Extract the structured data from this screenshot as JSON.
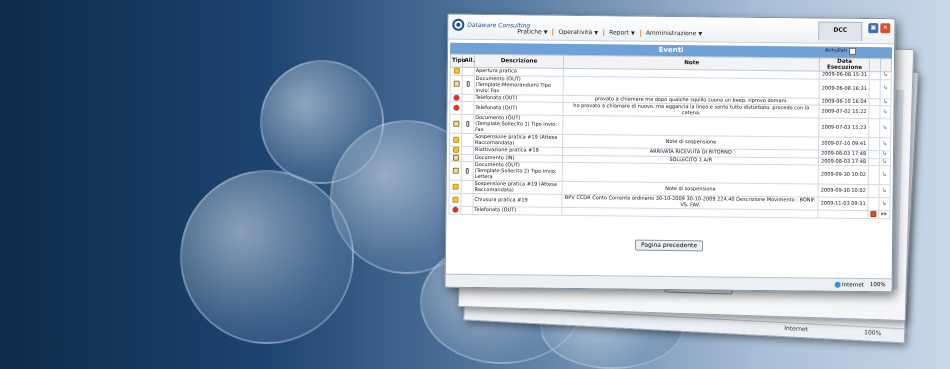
{
  "window": {
    "logo_text": "Dataware Consulting",
    "tab_label": "DCC",
    "menu": [
      "Pratiche",
      "Operatività",
      "Report",
      "Amministrazione"
    ],
    "section_title": "Eventi",
    "annullati_label": "Annullati",
    "columns": [
      "Tipo",
      "All.",
      "Descrizione",
      "Note",
      "Data Esecuzione"
    ],
    "rows": [
      {
        "icon": "folder-icon",
        "attach": false,
        "desc": "Apertura pratica",
        "note": "",
        "date": "2009-06-08 15:31"
      },
      {
        "icon": "document-icon",
        "attach": true,
        "desc": "Documento (OUT) (Template:Memorandum) Tipo invio: Fax",
        "note": "",
        "date": "2009-06-08 16:31"
      },
      {
        "icon": "phone-icon",
        "attach": false,
        "desc": "Telefonata (OUT)",
        "note": "provato a chiamare ma dopo qualche squillo suona un beep. riprovo domani.",
        "date": "2009-06-10 16:04"
      },
      {
        "icon": "phone-icon",
        "attach": false,
        "desc": "Telefonata (OUT)",
        "note": "ho provato a chiamare di nuovo. ma aggancia la linea e sento tutto disturbato. procedo con la catena.",
        "date": "2009-07-02 15:22"
      },
      {
        "icon": "document-icon",
        "attach": true,
        "desc": "Documento (OUT) (Template:Sollecito 1) Tipo invio: Fax",
        "note": "",
        "date": "2009-07-03 15:23"
      },
      {
        "icon": "folder-icon",
        "attach": false,
        "desc": "Sospensione pratica #19 (Attesa Raccomandata)",
        "note": "Note di sospensione",
        "date": "2009-07-10 09:41"
      },
      {
        "icon": "folder-icon",
        "attach": false,
        "desc": "Riattivazione pratica #19",
        "note": "ARRIVATA RICEVUTA DI RITORNO",
        "date": "2009-08-03 17:48"
      },
      {
        "icon": "document-icon",
        "attach": false,
        "desc": "Documento (IN)",
        "note": "SOLLECITO 1 A/R",
        "date": "2009-08-03 17:48"
      },
      {
        "icon": "document-icon",
        "attach": true,
        "desc": "Documento (OUT) (Template:Sollecito 2) Tipo invio: Lettera",
        "note": "",
        "date": "2009-09-30 10:02"
      },
      {
        "icon": "folder-icon",
        "attach": false,
        "desc": "Sospensione pratica #19 (Attesa Raccomandata)",
        "note": "Note di sospensione",
        "date": "2009-09-30 10:02"
      },
      {
        "icon": "folder-icon",
        "attach": false,
        "desc": "Chiusura pratica #19",
        "note": "BPV CCDR Conto Corrente ordinario 30-10-2009 30-10-2009 224.40 Descrizione Movimento : BONIF. VS. FAV.",
        "date": "2009-11-03 09:31"
      },
      {
        "icon": "phone-icon",
        "attach": false,
        "desc": "Telefonata (OUT)",
        "note": "",
        "date": ""
      }
    ],
    "prev_page": "Pagina precedente",
    "status_zone": "Internet",
    "zoom": "100%"
  },
  "back_window": {
    "prev_page": "Pagina precedente",
    "status_zone": "Internet",
    "zoom": "100%"
  }
}
